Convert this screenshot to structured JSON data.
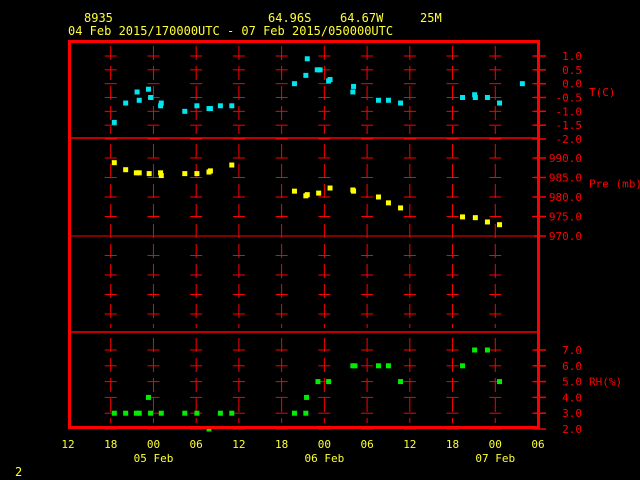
{
  "header": {
    "station": "8935",
    "lat": "64.96S",
    "lon": "64.67W",
    "elev": "25M",
    "range": "04 Feb 2015/170000UTC - 07 Feb 2015/050000UTC"
  },
  "footer_number": "2",
  "colors": {
    "frame": "#ff0000",
    "text": "#ffff33",
    "temp": "#00e5ee",
    "pres": "#ffff00",
    "rh": "#00ee00"
  },
  "chart_data": {
    "type": "scatter",
    "x_unit": "hours since 04 Feb 12Z",
    "xlim": [
      0,
      66
    ],
    "x_ticks": [
      {
        "h": 0,
        "label": "12"
      },
      {
        "h": 6,
        "label": "18"
      },
      {
        "h": 12,
        "label": "00"
      },
      {
        "h": 18,
        "label": "06"
      },
      {
        "h": 24,
        "label": "12"
      },
      {
        "h": 30,
        "label": "18"
      },
      {
        "h": 36,
        "label": "00"
      },
      {
        "h": 42,
        "label": "06"
      },
      {
        "h": 48,
        "label": "12"
      },
      {
        "h": 54,
        "label": "18"
      },
      {
        "h": 60,
        "label": "00"
      },
      {
        "h": 66,
        "label": "06"
      }
    ],
    "date_labels": [
      {
        "h": 12,
        "label": "05 Feb"
      },
      {
        "h": 36,
        "label": "06 Feb"
      },
      {
        "h": 60,
        "label": "07 Feb"
      }
    ],
    "panels": [
      {
        "name": "T(C)",
        "ylim": [
          -2.0,
          1.0
        ],
        "ticks": [
          "1.0",
          "0.5",
          "0.0",
          "-0.5",
          "-1.0",
          "-1.5",
          "-2.0"
        ],
        "tick_values": [
          1.0,
          0.5,
          0.0,
          -0.5,
          -1.0,
          -1.5,
          -2.0
        ],
        "points": [
          [
            6.5,
            -1.4
          ],
          [
            8.1,
            -0.7
          ],
          [
            9.7,
            -0.3
          ],
          [
            10.0,
            -0.6
          ],
          [
            11.3,
            -0.2
          ],
          [
            11.6,
            -0.5
          ],
          [
            13.0,
            -0.8
          ],
          [
            13.1,
            -0.7
          ],
          [
            16.4,
            -1.0
          ],
          [
            18.1,
            -0.8
          ],
          [
            19.8,
            -0.9
          ],
          [
            20.0,
            -0.9
          ],
          [
            21.4,
            -0.8
          ],
          [
            23.0,
            -0.8
          ],
          [
            31.8,
            0.0
          ],
          [
            33.4,
            0.3
          ],
          [
            33.6,
            0.9
          ],
          [
            35.0,
            0.5
          ],
          [
            35.4,
            0.5
          ],
          [
            36.6,
            0.1
          ],
          [
            36.8,
            0.15
          ],
          [
            40.0,
            -0.3
          ],
          [
            40.1,
            -0.1
          ],
          [
            43.6,
            -0.6
          ],
          [
            45.0,
            -0.6
          ],
          [
            46.7,
            -0.7
          ],
          [
            55.4,
            -0.5
          ],
          [
            57.1,
            -0.4
          ],
          [
            57.2,
            -0.5
          ],
          [
            58.9,
            -0.5
          ],
          [
            60.6,
            -0.7
          ],
          [
            63.8,
            0.0
          ]
        ]
      },
      {
        "name": "Pre (mb)",
        "ylim": [
          946.0,
          994.0
        ],
        "ticks": [
          "990.0",
          "985.0",
          "980.0",
          "975.0",
          "970.0"
        ],
        "tick_values": [
          990,
          985,
          980,
          975,
          970
        ],
        "points": [
          [
            6.5,
            988.8
          ],
          [
            8.1,
            987.0
          ],
          [
            9.6,
            986.2
          ],
          [
            10.0,
            986.2
          ],
          [
            11.4,
            986.0
          ],
          [
            13.0,
            986.2
          ],
          [
            13.1,
            985.5
          ],
          [
            16.4,
            986.0
          ],
          [
            18.1,
            986.0
          ],
          [
            19.8,
            986.4
          ],
          [
            20.0,
            986.7
          ],
          [
            23.0,
            988.2
          ],
          [
            31.8,
            981.5
          ],
          [
            33.4,
            980.3
          ],
          [
            33.6,
            980.6
          ],
          [
            35.2,
            981.0
          ],
          [
            36.8,
            982.3
          ],
          [
            40.0,
            981.8
          ],
          [
            40.1,
            981.5
          ],
          [
            43.6,
            980.0
          ],
          [
            45.0,
            978.5
          ],
          [
            46.7,
            977.2
          ],
          [
            55.4,
            974.9
          ],
          [
            57.2,
            974.7
          ],
          [
            58.9,
            973.6
          ],
          [
            60.6,
            972.9
          ]
        ]
      },
      {
        "name": "RH(%)",
        "ylim": [
          2.0,
          7.0
        ],
        "ticks": [
          "7.0",
          "6.0",
          "5.0",
          "4.0",
          "3.0",
          "2.0"
        ],
        "tick_values": [
          7,
          6,
          5,
          4,
          3,
          2
        ],
        "points": [
          [
            6.5,
            3
          ],
          [
            8.1,
            3
          ],
          [
            9.6,
            3
          ],
          [
            10.0,
            3
          ],
          [
            11.3,
            4
          ],
          [
            11.6,
            3
          ],
          [
            13.1,
            3
          ],
          [
            16.4,
            3
          ],
          [
            18.1,
            3
          ],
          [
            19.8,
            2
          ],
          [
            21.4,
            3
          ],
          [
            23.0,
            3
          ],
          [
            31.8,
            3
          ],
          [
            33.4,
            3
          ],
          [
            33.5,
            4
          ],
          [
            35.1,
            5
          ],
          [
            36.6,
            5
          ],
          [
            40.0,
            6
          ],
          [
            40.3,
            6
          ],
          [
            43.6,
            6
          ],
          [
            45.0,
            6
          ],
          [
            46.7,
            5
          ],
          [
            55.4,
            6
          ],
          [
            57.1,
            7
          ],
          [
            58.9,
            7
          ],
          [
            60.6,
            5
          ]
        ]
      }
    ]
  }
}
